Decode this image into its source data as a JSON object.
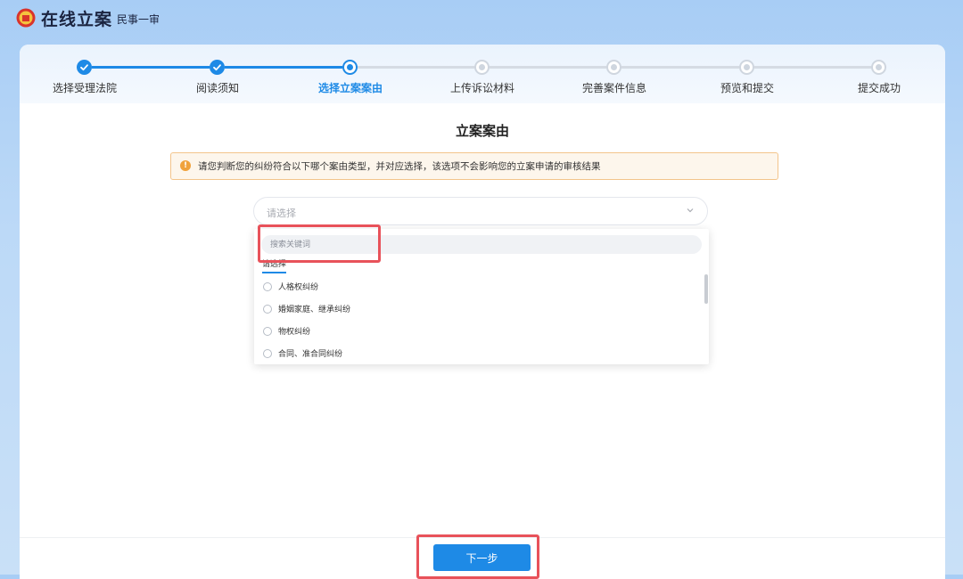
{
  "header": {
    "title": "在线立案",
    "subtitle": "民事一审",
    "emblem_icon": "court-emblem-icon"
  },
  "steps": [
    {
      "label": "选择受理法院",
      "status": "done"
    },
    {
      "label": "阅读须知",
      "status": "done"
    },
    {
      "label": "选择立案案由",
      "status": "current"
    },
    {
      "label": "上传诉讼材料",
      "status": "todo"
    },
    {
      "label": "完善案件信息",
      "status": "todo"
    },
    {
      "label": "预览和提交",
      "status": "todo"
    },
    {
      "label": "提交成功",
      "status": "todo"
    }
  ],
  "main": {
    "section_title": "立案案由",
    "notice": "请您判断您的纠纷符合以下哪个案由类型，并对应选择，该选项不会影响您的立案申请的审核结果",
    "select_placeholder": "请选择"
  },
  "dropdown": {
    "search_placeholder": "搜索关键词",
    "tab_label": "请选择",
    "options": [
      "人格权纠纷",
      "婚姻家庭、继承纠纷",
      "物权纠纷",
      "合同、准合同纠纷"
    ]
  },
  "footer": {
    "next_label": "下一步"
  },
  "colors": {
    "primary": "#1e8ae6",
    "highlight_box": "#e8525a",
    "notice_bg": "#fdf6ec",
    "notice_icon": "#f0a23b"
  }
}
